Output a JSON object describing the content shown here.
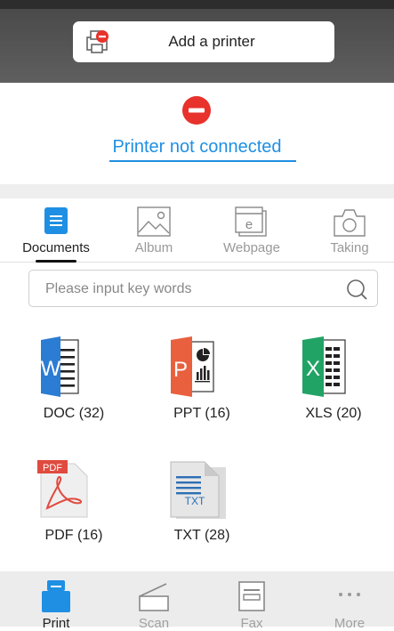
{
  "header": {
    "add_printer_label": "Add a printer"
  },
  "status": {
    "text": "Printer not connected"
  },
  "tabs": [
    {
      "label": "Documents"
    },
    {
      "label": "Album"
    },
    {
      "label": "Webpage"
    },
    {
      "label": "Taking"
    }
  ],
  "search": {
    "placeholder": "Please input key words"
  },
  "files": [
    {
      "label": "DOC (32)",
      "icon": "word-doc-icon"
    },
    {
      "label": "PPT (16)",
      "icon": "powerpoint-icon"
    },
    {
      "label": "XLS (20)",
      "icon": "excel-icon"
    },
    {
      "label": "PDF (16)",
      "icon": "pdf-icon"
    },
    {
      "label": "TXT (28)",
      "icon": "txt-icon"
    }
  ],
  "bottom_nav": [
    {
      "label": "Print"
    },
    {
      "label": "Scan"
    },
    {
      "label": "Fax"
    },
    {
      "label": "More"
    }
  ],
  "colors": {
    "accent": "#1f8fe3",
    "error": "#e8322c",
    "word": "#2b7cd3",
    "ppt": "#e9603f",
    "excel": "#21a366",
    "pdf": "#e04a3f"
  }
}
